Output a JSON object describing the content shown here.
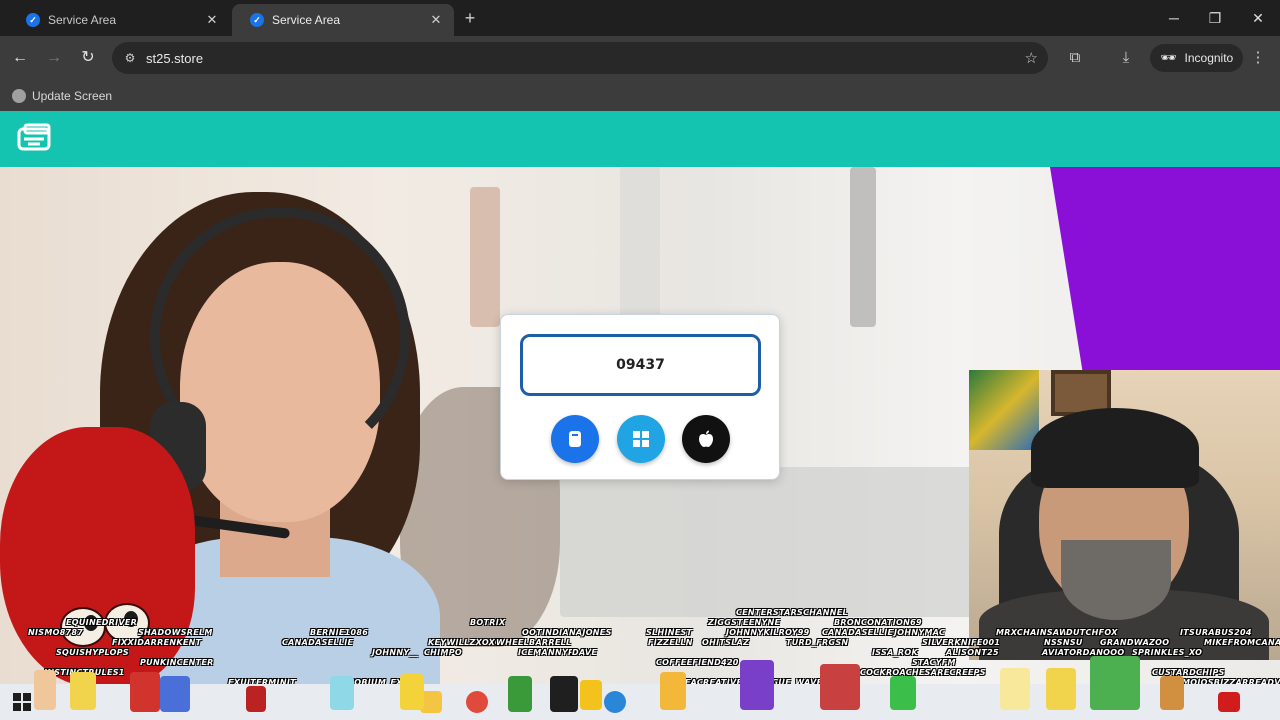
{
  "browser": {
    "tabs": [
      {
        "title": "Service Area",
        "active": false
      },
      {
        "title": "Service Area",
        "active": true
      }
    ],
    "url": "st25.store",
    "incognito_label": "Incognito",
    "bookmark": "Update Screen"
  },
  "dialog": {
    "code": "09437",
    "buttons": [
      {
        "name": "android",
        "color": "#1a73e8"
      },
      {
        "name": "windows",
        "color": "#21a4e3"
      },
      {
        "name": "apple",
        "color": "#111111"
      }
    ]
  },
  "colors": {
    "header": "#14c4b0",
    "accent_purple": "#8a10d8"
  },
  "overlay": {
    "usernames": [
      "EQUINEDRIVER",
      "NISMO8787",
      "SHADOWSREL​M",
      "FIXXIDARRENKENT",
      "SQUISHYPLOPS",
      "PUNKINCENTER",
      "INSTINCTRULES1",
      "BERNIE1086",
      "CANADASELLIE",
      "BOTRIX",
      "KEYWILLZXOXO",
      "WHEELBARRELL",
      "JOHNNY__",
      "CHIMPO",
      "ICEMANNYR",
      "DAVE",
      "OOTINDIANAJONES",
      "SLHINEST",
      "FIZZELLN",
      "CENTERSTARSCHANNEL",
      "ZIGGSTEENYNE",
      "JOHNNYKILROY99",
      "OHITSLAZ",
      "TURD_FRGSN",
      "BRONCONATION69",
      "CANADASELLIE",
      "JOHNYMAC",
      "COFFEEFIEND420",
      "ALDEACREATIVE",
      "ROGUE_WAVE",
      "ISSA_ROK",
      "STACYFM",
      "COCKROACHESARECREEPS",
      "SILVERKNIFE001",
      "ALISONT25",
      "MRXCHAINSAW",
      "DUTCHFOX",
      "NSSNSU",
      "GRANDWAZOO",
      "AVIATORDANOOO",
      "SPRINKLES_XO",
      "ITSURABUS204",
      "MIKEFROMCANADA",
      "CUSTARDCHIPS",
      "MOJOSBIZZARREADV",
      "EXUITERMINIT",
      "NIOBIUM_EXE"
    ]
  }
}
